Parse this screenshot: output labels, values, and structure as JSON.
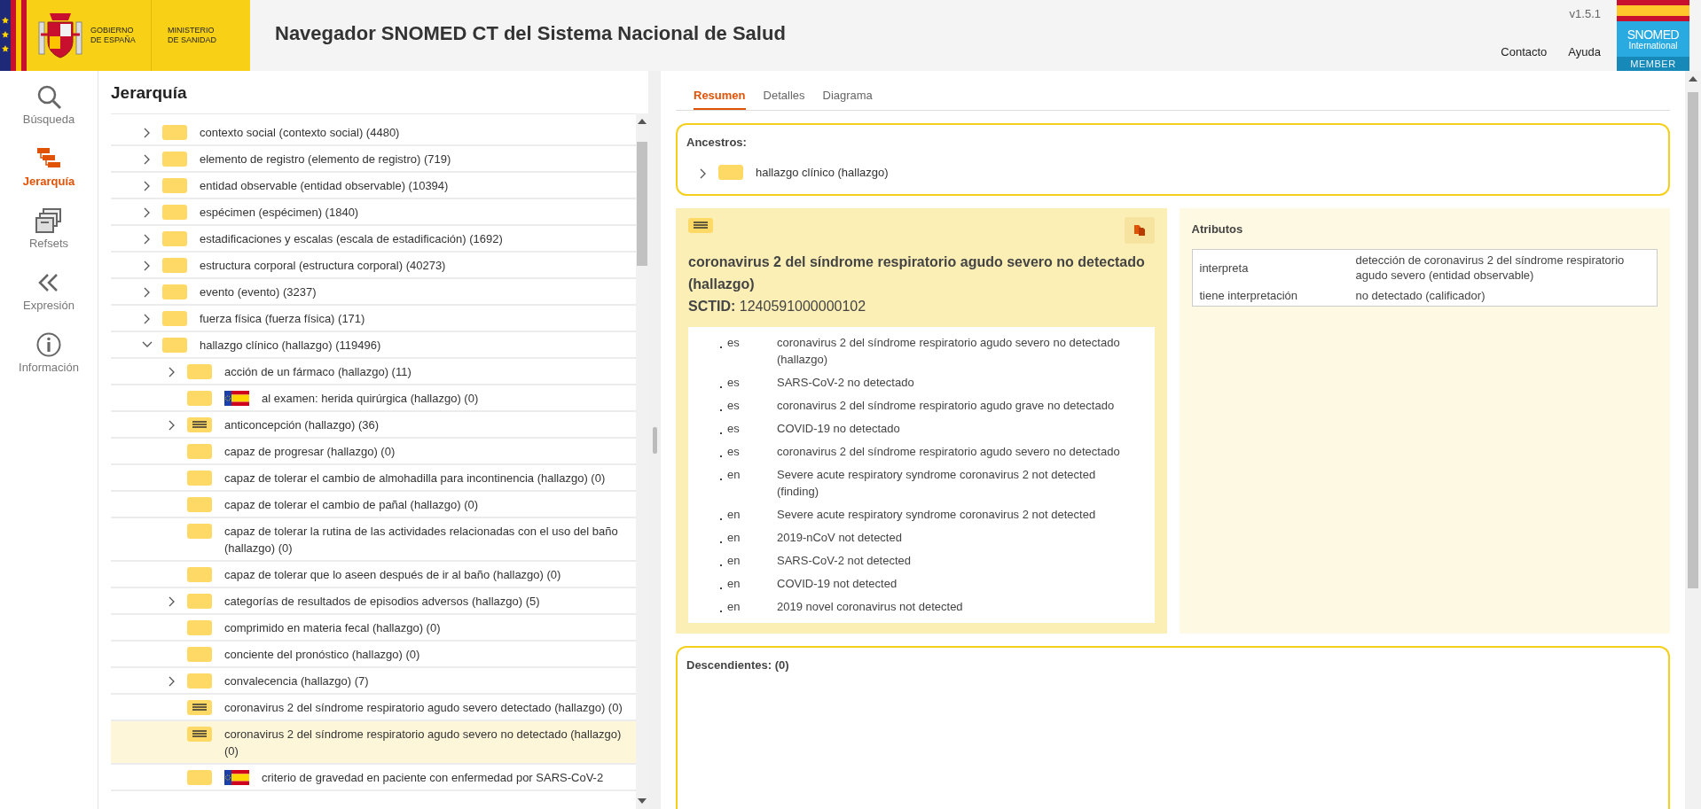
{
  "header": {
    "gov_text": "GOBIERNO\nDE ESPAÑA",
    "ministry_text": "MINISTERIO\nDE SANIDAD",
    "title": "Navegador SNOMED CT del Sistema Nacional de Salud",
    "version": "v1.5.1",
    "links": [
      "Contacto",
      "Ayuda"
    ],
    "badge": {
      "name": "SNOMED",
      "sub": "International",
      "tier": "MEMBER"
    }
  },
  "nav": [
    {
      "label": "Búsqueda",
      "kind": "search",
      "selected": false
    },
    {
      "label": "Jerarquía",
      "kind": "hierarchy",
      "selected": true
    },
    {
      "label": "Refsets",
      "kind": "refsets",
      "selected": false
    },
    {
      "label": "Expresión",
      "kind": "expression",
      "selected": false
    },
    {
      "label": "Información",
      "kind": "info",
      "selected": false
    }
  ],
  "hierarchy": {
    "title": "Jerarquía",
    "items": [
      {
        "label": "contexto social (contexto social) (4480)",
        "kind": "primitive",
        "has_children": true,
        "expanded": false,
        "extension": false,
        "selected": false
      },
      {
        "label": "elemento de registro (elemento de registro) (719)",
        "kind": "primitive",
        "has_children": true,
        "expanded": false,
        "extension": false,
        "selected": false
      },
      {
        "label": "entidad observable (entidad observable) (10394)",
        "kind": "primitive",
        "has_children": true,
        "expanded": false,
        "extension": false,
        "selected": false
      },
      {
        "label": "espécimen (espécimen) (1840)",
        "kind": "primitive",
        "has_children": true,
        "expanded": false,
        "extension": false,
        "selected": false
      },
      {
        "label": "estadificaciones y escalas (escala de estadificación) (1692)",
        "kind": "primitive",
        "has_children": true,
        "expanded": false,
        "extension": false,
        "selected": false
      },
      {
        "label": "estructura corporal (estructura corporal) (40273)",
        "kind": "primitive",
        "has_children": true,
        "expanded": false,
        "extension": false,
        "selected": false
      },
      {
        "label": "evento (evento) (3237)",
        "kind": "primitive",
        "has_children": true,
        "expanded": false,
        "extension": false,
        "selected": false
      },
      {
        "label": "fuerza física (fuerza física) (171)",
        "kind": "primitive",
        "has_children": true,
        "expanded": false,
        "extension": false,
        "selected": false
      },
      {
        "label": "hallazgo clínico (hallazgo) (119496)",
        "kind": "primitive",
        "has_children": true,
        "expanded": true,
        "extension": false,
        "selected": false,
        "children": [
          {
            "label": "acción de un fármaco (hallazgo) (11)",
            "kind": "primitive",
            "has_children": true,
            "expanded": false,
            "extension": false,
            "selected": false
          },
          {
            "label": "al examen: herida quirúrgica (hallazgo) (0)",
            "kind": "primitive",
            "has_children": false,
            "expanded": false,
            "extension": true,
            "selected": false
          },
          {
            "label": "anticoncepción (hallazgo) (36)",
            "kind": "defined",
            "has_children": true,
            "expanded": false,
            "extension": false,
            "selected": false
          },
          {
            "label": "capaz de progresar (hallazgo) (0)",
            "kind": "primitive",
            "has_children": false,
            "expanded": false,
            "extension": false,
            "selected": false
          },
          {
            "label": "capaz de tolerar el cambio de almohadilla para incontinencia (hallazgo) (0)",
            "kind": "primitive",
            "has_children": false,
            "expanded": false,
            "extension": false,
            "selected": false
          },
          {
            "label": "capaz de tolerar el cambio de pañal (hallazgo) (0)",
            "kind": "primitive",
            "has_children": false,
            "expanded": false,
            "extension": false,
            "selected": false
          },
          {
            "label": "capaz de tolerar la rutina de las actividades relacionadas con el uso del baño (hallazgo) (0)",
            "kind": "primitive",
            "has_children": false,
            "expanded": false,
            "extension": false,
            "selected": false
          },
          {
            "label": "capaz de tolerar que lo aseen después de ir al baño (hallazgo) (0)",
            "kind": "primitive",
            "has_children": false,
            "expanded": false,
            "extension": false,
            "selected": false
          },
          {
            "label": "categorías de resultados de episodios adversos (hallazgo) (5)",
            "kind": "primitive",
            "has_children": true,
            "expanded": false,
            "extension": false,
            "selected": false
          },
          {
            "label": "comprimido en materia fecal (hallazgo) (0)",
            "kind": "primitive",
            "has_children": false,
            "expanded": false,
            "extension": false,
            "selected": false
          },
          {
            "label": "conciente del pronóstico (hallazgo) (0)",
            "kind": "primitive",
            "has_children": false,
            "expanded": false,
            "extension": false,
            "selected": false
          },
          {
            "label": "convalecencia (hallazgo) (7)",
            "kind": "primitive",
            "has_children": true,
            "expanded": false,
            "extension": false,
            "selected": false
          },
          {
            "label": "coronavirus 2 del síndrome respiratorio agudo severo detectado (hallazgo) (0)",
            "kind": "defined",
            "has_children": false,
            "expanded": false,
            "extension": false,
            "selected": false
          },
          {
            "label": "coronavirus 2 del síndrome respiratorio agudo severo no detectado (hallazgo) (0)",
            "kind": "defined",
            "has_children": false,
            "expanded": false,
            "extension": false,
            "selected": true
          },
          {
            "label": "criterio de gravedad en paciente con enfermedad por SARS-CoV-2",
            "kind": "primitive",
            "has_children": false,
            "expanded": false,
            "extension": true,
            "selected": false
          }
        ]
      }
    ]
  },
  "tabs": [
    {
      "label": "Resumen",
      "selected": true
    },
    {
      "label": "Detalles",
      "selected": false
    },
    {
      "label": "Diagrama",
      "selected": false
    }
  ],
  "ancestors": {
    "title": "Ancestros:",
    "items": [
      {
        "label": "hallazgo clínico (hallazgo)",
        "kind": "primitive",
        "has_children": true,
        "expanded": false
      }
    ]
  },
  "concept": {
    "kind": "defined",
    "name": "coronavirus 2 del síndrome respiratorio agudo severo no detectado (hallazgo)",
    "sctid_label": "SCTID:",
    "sctid": "1240591000000102",
    "descriptions": [
      {
        "lang": "es",
        "term": "coronavirus 2 del síndrome respiratorio agudo severo no detectado (hallazgo)"
      },
      {
        "lang": "es",
        "term": "SARS-CoV-2 no detectado"
      },
      {
        "lang": "es",
        "term": "coronavirus 2 del síndrome respiratorio agudo grave no detectado"
      },
      {
        "lang": "es",
        "term": "COVID-19 no detectado"
      },
      {
        "lang": "es",
        "term": "coronavirus 2 del síndrome respiratorio agudo severo no detectado"
      },
      {
        "lang": "en",
        "term": "Severe acute respiratory syndrome coronavirus 2 not detected (finding)"
      },
      {
        "lang": "en",
        "term": "Severe acute respiratory syndrome coronavirus 2 not detected"
      },
      {
        "lang": "en",
        "term": "2019-nCoV not detected"
      },
      {
        "lang": "en",
        "term": "SARS-CoV-2 not detected"
      },
      {
        "lang": "en",
        "term": "COVID-19 not detected"
      },
      {
        "lang": "en",
        "term": "2019 novel coronavirus not detected"
      }
    ]
  },
  "attributes": {
    "title": "Atributos",
    "rows": [
      {
        "name": "interpreta",
        "value": "detección de coronavirus 2 del síndrome respiratorio agudo severo (entidad observable)"
      },
      {
        "name": "tiene interpretación",
        "value": "no detectado (calificador)"
      }
    ]
  },
  "descendants": {
    "title": "Descendientes: (0)"
  }
}
